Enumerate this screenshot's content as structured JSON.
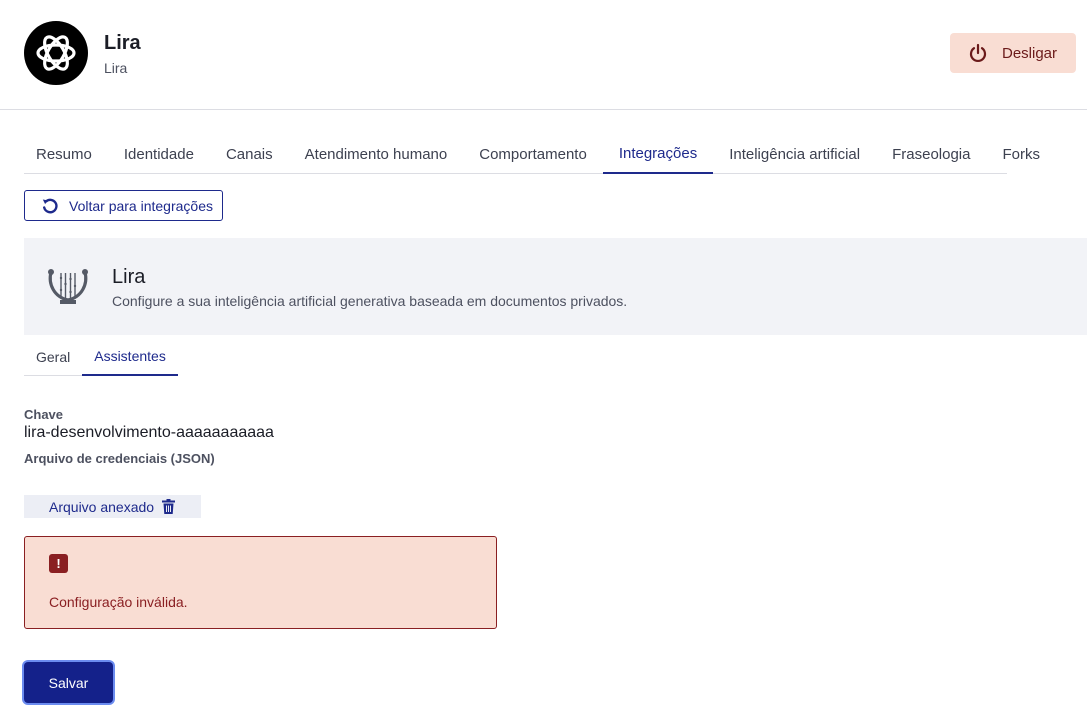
{
  "header": {
    "title": "Lira",
    "subtitle": "Lira",
    "power_button_label": "Desligar"
  },
  "tabs": [
    {
      "label": "Resumo"
    },
    {
      "label": "Identidade"
    },
    {
      "label": "Canais"
    },
    {
      "label": "Atendimento humano"
    },
    {
      "label": "Comportamento"
    },
    {
      "label": "Integrações",
      "active": true
    },
    {
      "label": "Inteligência artificial"
    },
    {
      "label": "Fraseologia"
    },
    {
      "label": "Forks"
    }
  ],
  "back_button_label": "Voltar para integrações",
  "integration": {
    "icon": "lyre-icon",
    "title": "Lira",
    "description": "Configure a sua inteligência artificial generativa baseada em documentos privados."
  },
  "subtabs": [
    {
      "label": "Geral"
    },
    {
      "label": "Assistentes",
      "active": true
    }
  ],
  "form": {
    "key_label": "Chave",
    "key_value": "lira-desenvolvimento-aaaaaaaaaaa",
    "credentials_label": "Arquivo de credenciais (JSON)",
    "attached_file_label": "Arquivo anexado"
  },
  "alert": {
    "message": "Configuração inválida."
  },
  "save_button_label": "Salvar",
  "colors": {
    "primary": "#1e2a8c",
    "error": "#8a1f22",
    "error_bg": "#f9ddd3"
  }
}
